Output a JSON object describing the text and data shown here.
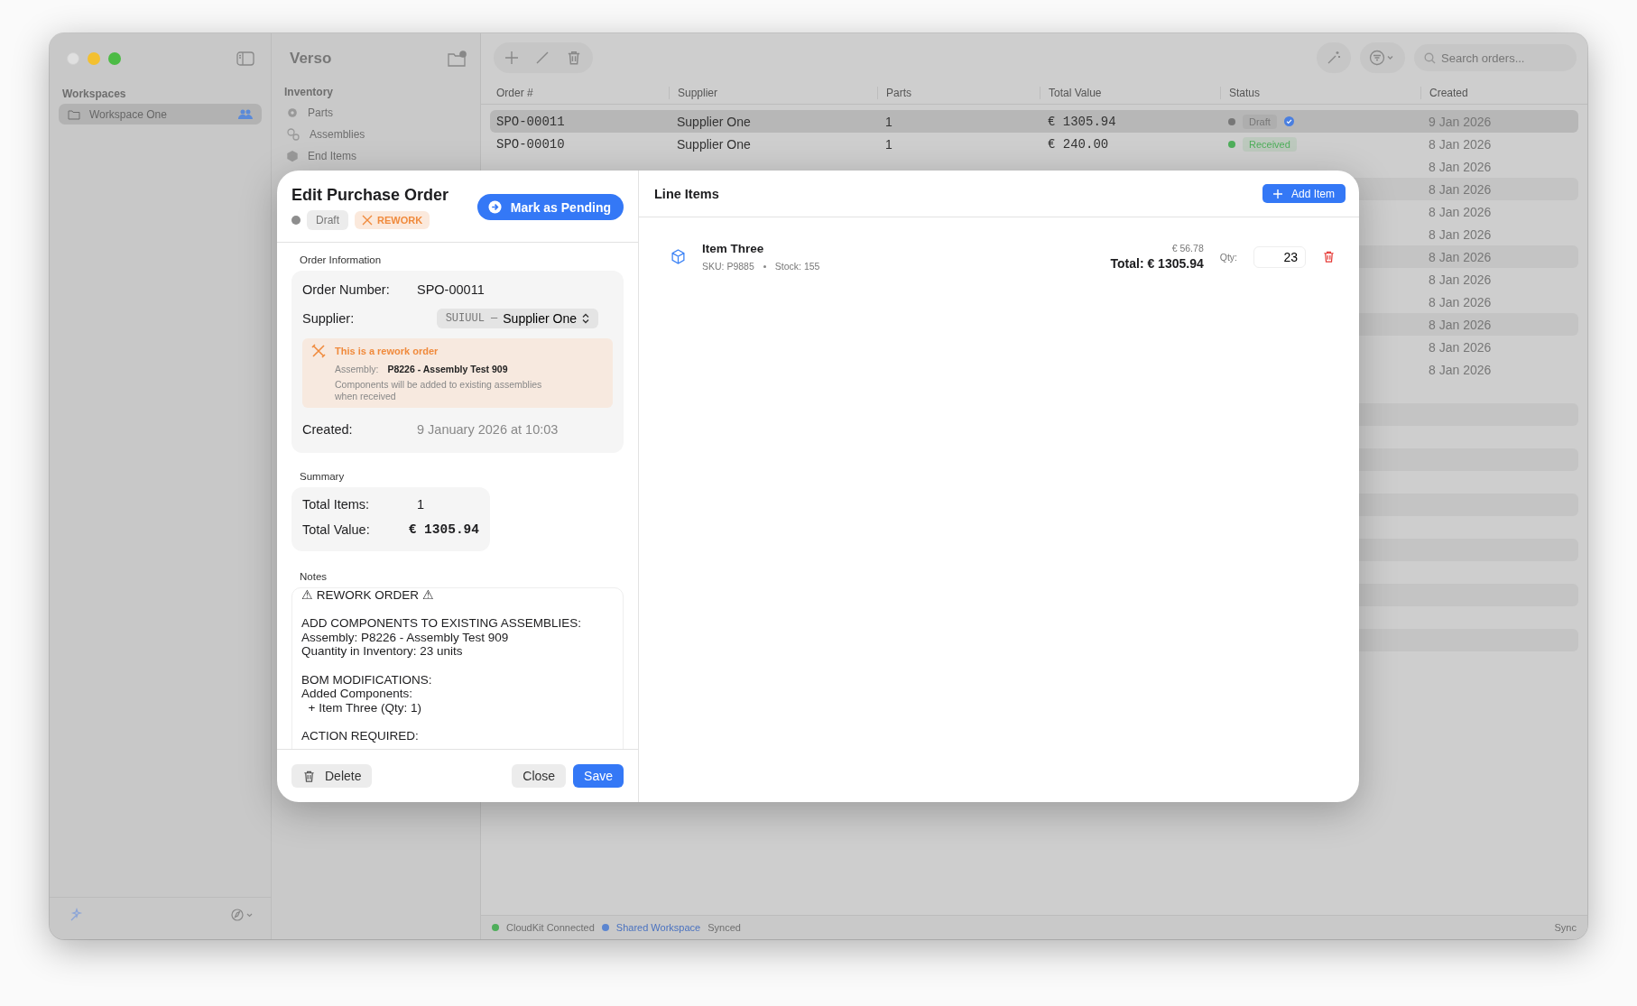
{
  "app_title": "Verso",
  "sidebar": {
    "section": "Workspaces",
    "items": [
      {
        "label": "Workspace One",
        "selected": true,
        "shared": true
      }
    ]
  },
  "inventory": {
    "section": "Inventory",
    "items": [
      {
        "label": "Parts",
        "kind": "part"
      },
      {
        "label": "Assemblies",
        "kind": "assembly"
      },
      {
        "label": "End Items",
        "kind": "end"
      }
    ]
  },
  "toolbar": {
    "search": {
      "placeholder": "Search orders..."
    }
  },
  "table": {
    "columns": [
      "Order #",
      "Supplier",
      "Parts",
      "Total Value",
      "Status",
      "Created"
    ],
    "rows": [
      {
        "order": "SPO-00011",
        "supplier": "Supplier One",
        "parts": "1",
        "total": "€ 1305.94",
        "status": "Draft",
        "color": "#777777",
        "flagged": true,
        "created": "9 Jan 2026",
        "selected": true
      },
      {
        "order": "SPO-00010",
        "supplier": "Supplier One",
        "parts": "1",
        "total": "€ 240.00",
        "status": "Received",
        "color": "#4fae5b",
        "flagged": false,
        "created": "8 Jan 2026",
        "selected": false
      },
      {
        "created": "8 Jan 2026",
        "selected": false
      },
      {
        "created": "8 Jan 2026",
        "selected": false
      },
      {
        "created": "8 Jan 2026",
        "selected": false
      },
      {
        "created": "8 Jan 2026",
        "selected": false
      },
      {
        "created": "8 Jan 2026",
        "selected": false
      },
      {
        "created": "8 Jan 2026",
        "selected": false
      },
      {
        "created": "8 Jan 2026",
        "selected": false
      },
      {
        "created": "8 Jan 2026",
        "selected": false
      },
      {
        "created": "8 Jan 2026",
        "selected": false
      },
      {
        "created": "8 Jan 2026",
        "selected": false
      }
    ]
  },
  "status_bar": {
    "items": [
      {
        "label": "CloudKit Connected",
        "color": "#4fae5b",
        "link": false
      },
      {
        "label": "Shared Workspace",
        "color": "#5b85d0",
        "link": true
      }
    ],
    "state": "Synced",
    "action": "Sync"
  },
  "modal": {
    "title": "Edit Purchase Order",
    "status": {
      "label": "Draft",
      "color": "#8e8e8e"
    },
    "tag": "REWORK",
    "primary_action": "Mark as Pending",
    "order_info": {
      "heading": "Order Information",
      "order_number_label": "Order Number:",
      "order_number": "SPO-00011",
      "supplier_label": "Supplier:",
      "supplier_code": "SUIUUL —",
      "supplier_name": "Supplier One",
      "notice": {
        "title": "This is a rework order",
        "assembly_label": "Assembly:",
        "assembly": "P8226 - Assembly Test 909",
        "note": "Components will be added to existing assemblies when received"
      },
      "created_label": "Created:",
      "created": "9 January 2026 at 10:03"
    },
    "summary": {
      "heading": "Summary",
      "rows": [
        {
          "label": "Total Items:",
          "value": "1"
        },
        {
          "label": "Total Value:",
          "value": "€ 1305.94"
        }
      ]
    },
    "notes": {
      "heading": "Notes",
      "value": "⚠ REWORK ORDER ⚠\n\nADD COMPONENTS TO EXISTING ASSEMBLIES:\nAssembly: P8226 - Assembly Test 909\nQuantity in Inventory: 23 units\n\nBOM MODIFICATIONS:\nAdded Components:\n  + Item Three (Qty: 1)\n\nACTION REQUIRED:"
    },
    "footer": {
      "delete": "Delete",
      "close": "Close",
      "save": "Save"
    },
    "line_items": {
      "title": "Line Items",
      "add": "Add Item",
      "items": [
        {
          "name": "Item Three",
          "sku": "SKU: P9885",
          "stock": "Stock: 155",
          "unit_price": "€ 56.78",
          "total": "Total: € 1305.94",
          "qty_label": "Qty:",
          "qty": "23"
        }
      ]
    }
  }
}
